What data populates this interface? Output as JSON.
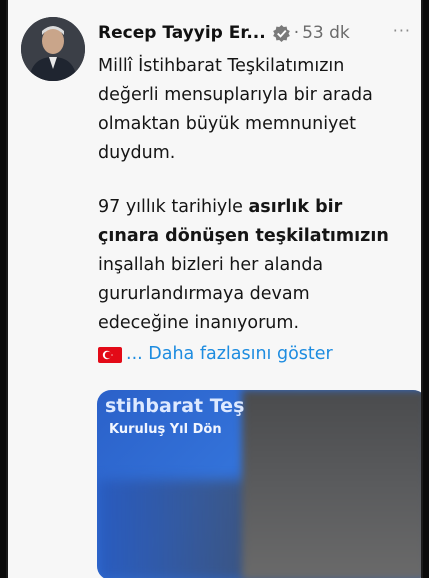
{
  "tweet": {
    "author_name": "Recep Tayyip Er...",
    "separator": "·",
    "time": "53 dk",
    "more_label": "···",
    "text_lines_1": [
      "Millî İstihbarat Teşkilatımızın",
      "değerli mensuplarıyla bir arada",
      "olmaktan büyük memnuniyet",
      "duydum."
    ],
    "text_lines_2_prefix": "97 yıllık tarihiyle ",
    "text_lines_2_bold": "asırlık bir",
    "text_lines_2_line2": "çınara dönüşen teşkilatımızın",
    "text_lines_2_rest": [
      "inşallah bizleri her alanda",
      "gururlandırmaya devam",
      "edeceğine inanıyorum."
    ],
    "show_more": "... Daha fazlasını göster"
  },
  "card": {
    "title": "stihbarat Teş",
    "subtitle": "Kuruluş Yıl Dön"
  },
  "colors": {
    "link": "#1d8ce0",
    "verified": "#7a7a7a",
    "flag": "#e30a17"
  },
  "icons": [
    "verified-badge-icon",
    "turkish-flag-icon",
    "more-options-icon"
  ]
}
